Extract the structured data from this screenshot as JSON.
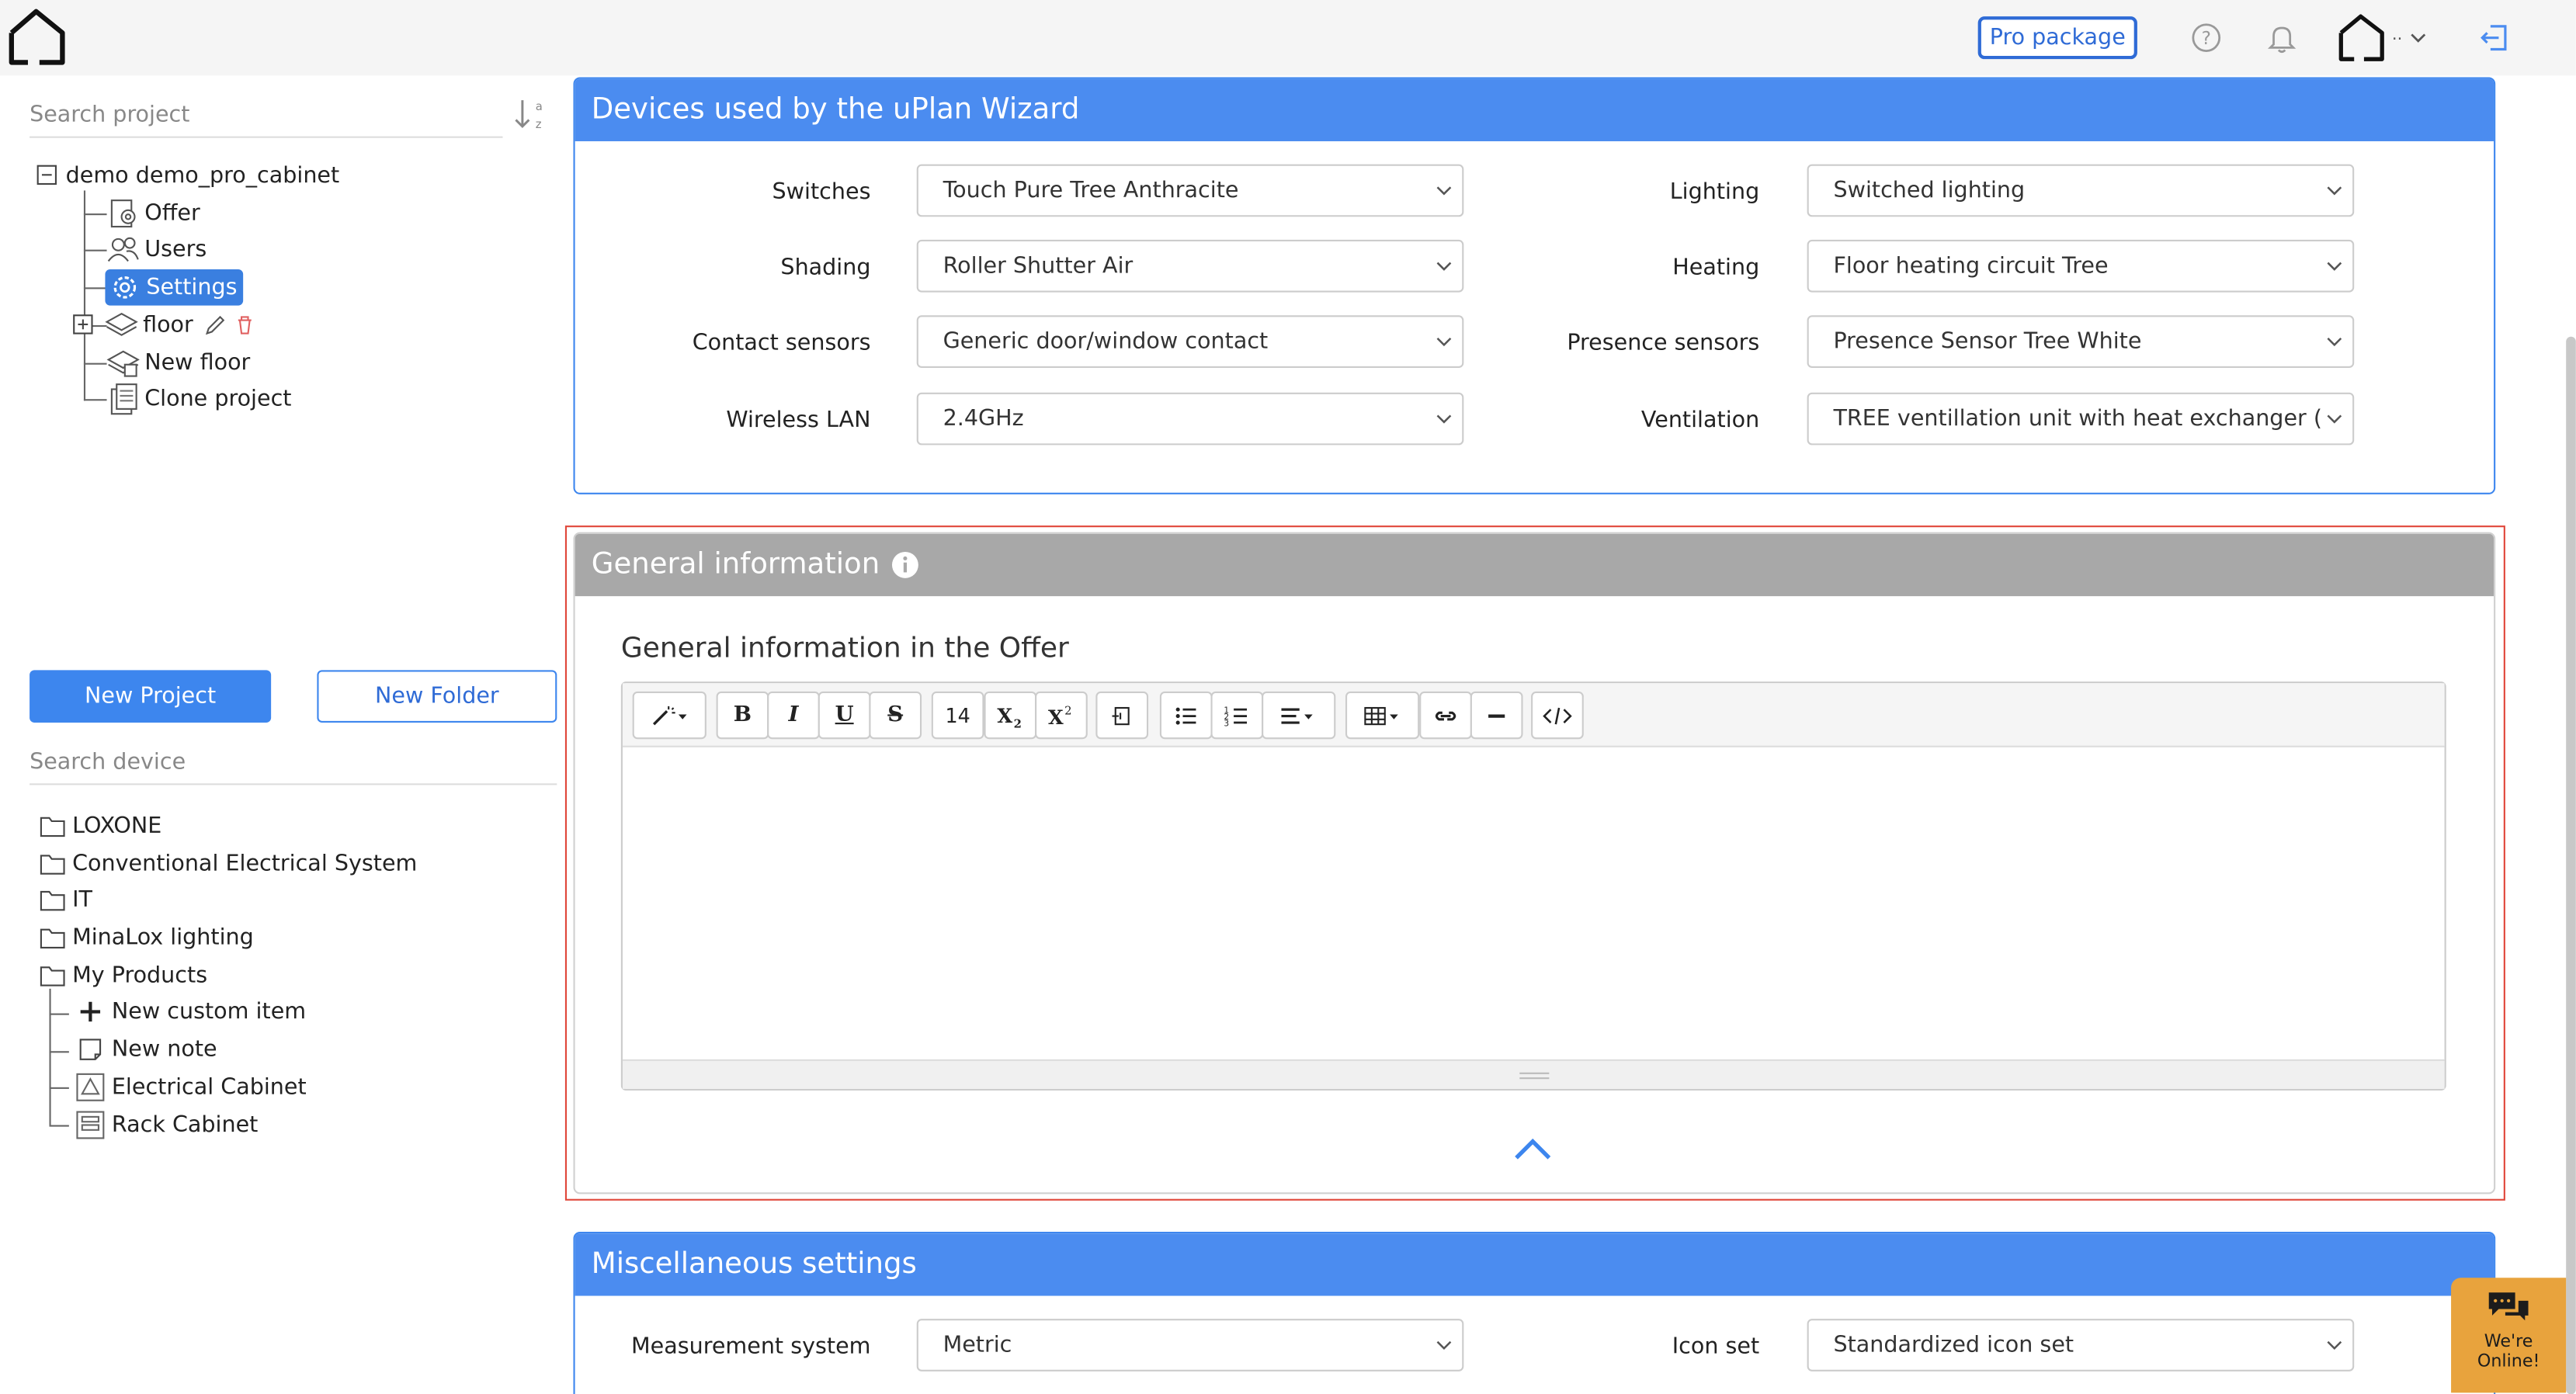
{
  "header": {
    "pro_package": "Pro package",
    "user_initial": ".."
  },
  "sidebar": {
    "search_project_placeholder": "Search project",
    "project_tree": {
      "root": "demo demo_pro_cabinet",
      "items": [
        {
          "label": "Offer",
          "icon": "offer-icon"
        },
        {
          "label": "Users",
          "icon": "users-icon"
        },
        {
          "label": "Settings",
          "icon": "settings-icon",
          "selected": true
        },
        {
          "label": "floor",
          "icon": "layers-icon"
        },
        {
          "label": "New floor",
          "icon": "new-floor-icon"
        },
        {
          "label": "Clone project",
          "icon": "clone-icon"
        }
      ]
    },
    "new_project": "New Project",
    "new_folder": "New Folder",
    "search_device_placeholder": "Search device",
    "device_tree": {
      "folders": [
        "LOXONE",
        "Conventional Electrical System",
        "IT",
        "MinaLox lighting",
        "My Products"
      ],
      "my_products_items": [
        {
          "label": "New custom item",
          "icon": "plus-icon"
        },
        {
          "label": "New note",
          "icon": "note-icon"
        },
        {
          "label": "Electrical Cabinet",
          "icon": "electrical-cabinet-icon"
        },
        {
          "label": "Rack Cabinet",
          "icon": "rack-cabinet-icon"
        }
      ]
    }
  },
  "devices_panel": {
    "title": "Devices used by the uPlan Wizard",
    "fields": [
      {
        "label": "Switches",
        "value": "Touch Pure Tree Anthracite"
      },
      {
        "label": "Lighting",
        "value": "Switched lighting"
      },
      {
        "label": "Shading",
        "value": "Roller Shutter Air"
      },
      {
        "label": "Heating",
        "value": "Floor heating circuit Tree"
      },
      {
        "label": "Contact sensors",
        "value": "Generic door/window contact"
      },
      {
        "label": "Presence sensors",
        "value": "Presence Sensor Tree White"
      },
      {
        "label": "Wireless LAN",
        "value": "2.4GHz"
      },
      {
        "label": "Ventilation",
        "value": "TREE ventillation unit with heat exchanger (wall"
      }
    ]
  },
  "general_panel": {
    "title": "General information",
    "editor_label": "General information in the Offer",
    "font_size": "14"
  },
  "misc_panel": {
    "title": "Miscellaneous settings",
    "fields": [
      {
        "label": "Measurement system",
        "value": "Metric"
      },
      {
        "label": "Icon set",
        "value": "Standardized icon set"
      }
    ]
  },
  "chat": {
    "line1": "We're",
    "line2": "Online!"
  },
  "colors": {
    "accent": "#4b8cf0",
    "primary_button": "#3d86ee",
    "highlight": "#e0473a",
    "gray_header": "#a8a8a8",
    "chat": "#e8a33d"
  }
}
